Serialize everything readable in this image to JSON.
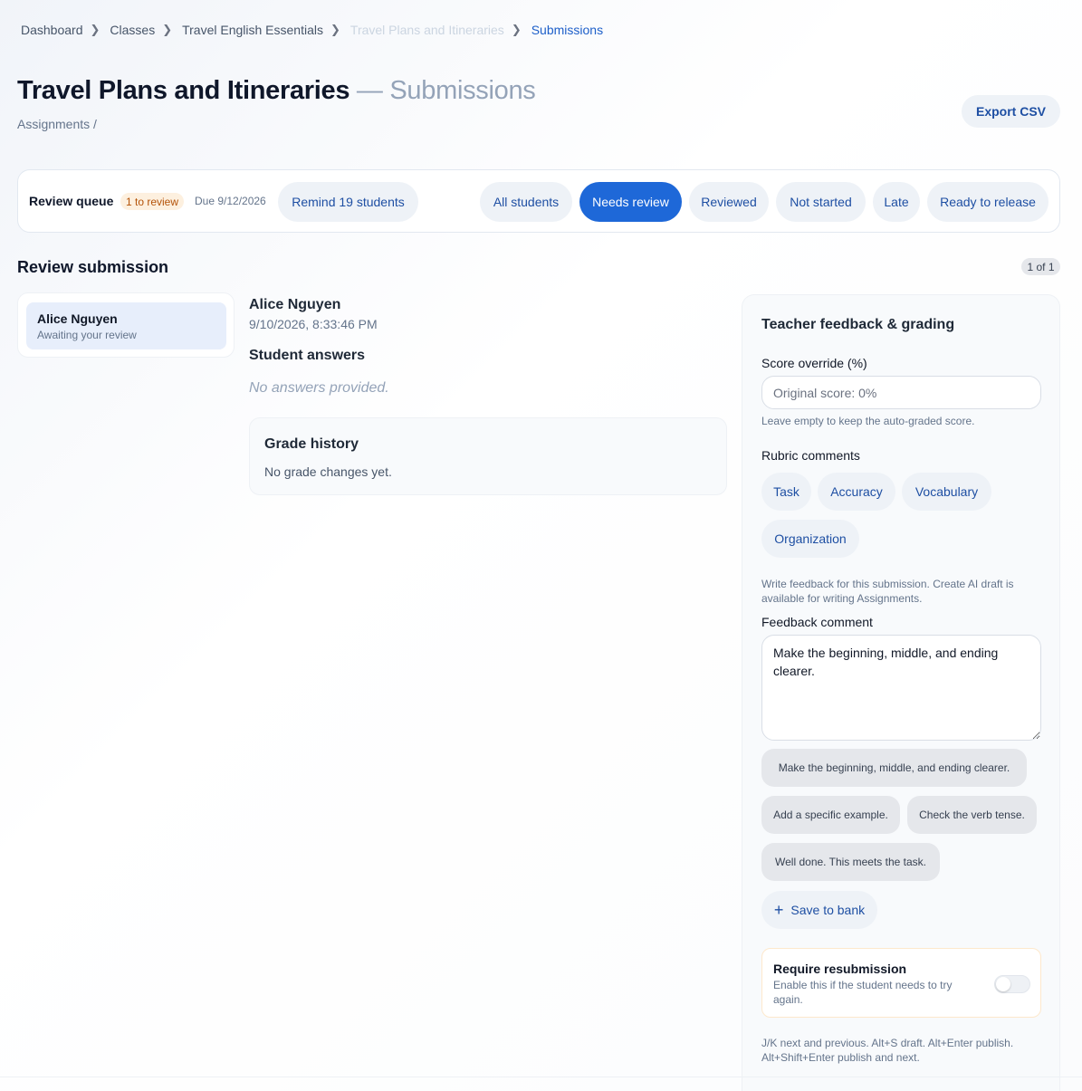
{
  "breadcrumb": {
    "items": [
      "Dashboard",
      "Classes",
      "Travel English Essentials",
      "Travel Plans and Itineraries",
      "Submissions"
    ],
    "chevron_icon": "chevron-right-icon"
  },
  "header": {
    "title": "Travel Plans and Itineraries",
    "title_suffix": " — Submissions",
    "subline": "Assignments /",
    "export_label": "Export CSV"
  },
  "queue": {
    "label": "Review queue",
    "badge": "1 to review",
    "due": "Due 9/12/2026",
    "remind_label": "Remind 19 students",
    "filters": [
      "All students",
      "Needs review",
      "Reviewed",
      "Not started",
      "Late",
      "Ready to release"
    ],
    "active_filter": "Needs review"
  },
  "review": {
    "title": "Review submission",
    "count": "1 of 1",
    "students": [
      {
        "name": "Alice Nguyen",
        "status": "Awaiting your review"
      }
    ]
  },
  "submission": {
    "name": "Alice Nguyen",
    "timestamp": "9/10/2026, 8:33:46 PM",
    "answers_title": "Student answers",
    "no_answers": "No answers provided.",
    "grade_history_title": "Grade history",
    "grade_history_empty": "No grade changes yet."
  },
  "feedback": {
    "title": "Teacher feedback & grading",
    "score_label": "Score override (%)",
    "score_placeholder": "Original score: 0%",
    "score_value": "",
    "score_help": "Leave empty to keep the auto-graded score.",
    "rubric_label": "Rubric comments",
    "rubric": [
      "Task",
      "Accuracy",
      "Vocabulary",
      "Organization"
    ],
    "feedback_help": "Write feedback for this submission. Create AI draft is available for writing Assignments.",
    "comment_label": "Feedback comment",
    "comment_value": "Make the beginning, middle, and ending clearer.",
    "bank": [
      "Make the beginning, middle, and ending clearer.",
      "Add a specific example.",
      "Check the verb tense.",
      "Well done. This meets the task."
    ],
    "save_bank_label": "Save to bank",
    "resubmission_title": "Require resubmission",
    "resubmission_desc": "Enable this if the student needs to try again.",
    "resubmission_enabled": false,
    "shortcuts": "J/K next and previous. Alt+S draft. Alt+Enter publish. Alt+Shift+Enter publish and next."
  },
  "colors": {
    "accent": "#1e68d8",
    "link": "#1e4fa3",
    "badge_bg": "#fdf0df",
    "badge_text": "#b45309"
  }
}
